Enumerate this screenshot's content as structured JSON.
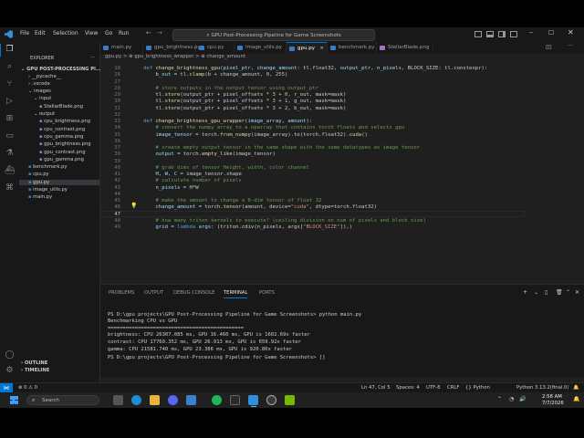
{
  "title_menu": [
    "File",
    "Edit",
    "Selection",
    "View",
    "Go",
    "Run"
  ],
  "command_center": "GPU Post-Processing Pipeline for Game Screenshots",
  "explorer": {
    "header": "EXPLORER",
    "root": "GPU POST-PROCESSING PI...",
    "items": [
      {
        "label": "__pycache__",
        "depth": 1,
        "kind": "folder-closed"
      },
      {
        "label": ".vscode",
        "depth": 1,
        "kind": "folder-closed"
      },
      {
        "label": "images",
        "depth": 1,
        "kind": "folder-open"
      },
      {
        "label": "input",
        "depth": 2,
        "kind": "folder-open"
      },
      {
        "label": "StellarBlade.png",
        "depth": 3,
        "kind": "file"
      },
      {
        "label": "output",
        "depth": 2,
        "kind": "folder-open"
      },
      {
        "label": "cpu_brightness.png",
        "depth": 3,
        "kind": "file"
      },
      {
        "label": "cpu_contrast.png",
        "depth": 3,
        "kind": "file"
      },
      {
        "label": "cpu_gamma.png",
        "depth": 3,
        "kind": "file"
      },
      {
        "label": "gpu_brightness.png",
        "depth": 3,
        "kind": "file"
      },
      {
        "label": "gpu_contrast.png",
        "depth": 3,
        "kind": "file"
      },
      {
        "label": "gpu_gamma.png",
        "depth": 3,
        "kind": "file"
      },
      {
        "label": "benchmark.py",
        "depth": 1,
        "kind": "file"
      },
      {
        "label": "cpu.py",
        "depth": 1,
        "kind": "file"
      },
      {
        "label": "gpu.py",
        "depth": 1,
        "kind": "file",
        "selected": true
      },
      {
        "label": "image_utils.py",
        "depth": 1,
        "kind": "file"
      },
      {
        "label": "main.py",
        "depth": 1,
        "kind": "file"
      }
    ],
    "outline": "OUTLINE",
    "timeline": "TIMELINE"
  },
  "tabs": [
    {
      "label": "main.py",
      "active": false
    },
    {
      "label": "gpu_brightness.py",
      "active": false
    },
    {
      "label": "cpu.py",
      "active": false
    },
    {
      "label": "image_utils.py",
      "active": false
    },
    {
      "label": "gpu.py",
      "active": true
    },
    {
      "label": "benchmark.py",
      "active": false
    },
    {
      "label": "StellarBlade.png",
      "active": false
    }
  ],
  "breadcrumb": "gpu.py > ⊕ gpu_brightness_wrapper > ⊕ change_amount",
  "code_lines": [
    {
      "n": "18",
      "parts": [
        [
          "kw",
          "def "
        ],
        [
          "fn",
          "change_brightness_gpu"
        ],
        [
          "",
          "("
        ],
        [
          "var",
          "pixel_ptr"
        ],
        [
          "",
          ", "
        ],
        [
          "var",
          "change_amount"
        ],
        [
          "",
          ": tl.float32, "
        ],
        [
          "var",
          "output_ptr"
        ],
        [
          "",
          ", "
        ],
        [
          "var",
          "n_pixels"
        ],
        [
          "",
          ", BLOCK_SIZE: tl.constexpr):"
        ]
      ]
    },
    {
      "n": "26",
      "parts": [
        [
          "",
          "    "
        ],
        [
          "var",
          "b_out"
        ],
        [
          "",
          " = tl."
        ],
        [
          "fn",
          "clamp"
        ],
        [
          "",
          "(b + change_amount, "
        ],
        [
          "num",
          "0"
        ],
        [
          "",
          ", "
        ],
        [
          "num",
          "255"
        ],
        [
          "",
          ")"
        ]
      ]
    },
    {
      "n": "27",
      "parts": [
        [
          "",
          ""
        ]
      ]
    },
    {
      "n": "28",
      "parts": [
        [
          "cm",
          "    # store outputs in the output tensor using output_ptr"
        ]
      ]
    },
    {
      "n": "29",
      "parts": [
        [
          "",
          "    tl."
        ],
        [
          "fn",
          "store"
        ],
        [
          "",
          "(output_ptr + pixel_offsets * "
        ],
        [
          "num",
          "3"
        ],
        [
          "",
          " + "
        ],
        [
          "num",
          "0"
        ],
        [
          "",
          ", r_out, mask=mask)"
        ]
      ]
    },
    {
      "n": "30",
      "parts": [
        [
          "",
          "    tl."
        ],
        [
          "fn",
          "store"
        ],
        [
          "",
          "(output_ptr + pixel_offsets * "
        ],
        [
          "num",
          "3"
        ],
        [
          "",
          " + "
        ],
        [
          "num",
          "1"
        ],
        [
          "",
          ", g_out, mask=mask)"
        ]
      ]
    },
    {
      "n": "31",
      "parts": [
        [
          "",
          "    tl."
        ],
        [
          "fn",
          "store"
        ],
        [
          "",
          "(output_ptr + pixel_offsets * "
        ],
        [
          "num",
          "3"
        ],
        [
          "",
          " + "
        ],
        [
          "num",
          "2"
        ],
        [
          "",
          ", b_out, mask=mask)"
        ]
      ]
    },
    {
      "n": "32",
      "parts": [
        [
          "",
          ""
        ]
      ]
    },
    {
      "n": "33",
      "parts": [
        [
          "kw",
          "def "
        ],
        [
          "fn",
          "change_brightness_gpu_wrapper"
        ],
        [
          "",
          "("
        ],
        [
          "var",
          "image_array"
        ],
        [
          "",
          ", "
        ],
        [
          "var",
          "amount"
        ],
        [
          "",
          "):"
        ]
      ]
    },
    {
      "n": "34",
      "parts": [
        [
          "cm",
          "    # convert the numpy array to a nparray that contains torch floats and selects gpu"
        ]
      ]
    },
    {
      "n": "35",
      "parts": [
        [
          "",
          "    "
        ],
        [
          "var",
          "image_tensor"
        ],
        [
          "",
          " = torch."
        ],
        [
          "fn",
          "from_numpy"
        ],
        [
          "",
          "(image_array)."
        ],
        [
          "fn",
          "to"
        ],
        [
          "",
          "(torch.float32)."
        ],
        [
          "fn",
          "cuda"
        ],
        [
          "",
          "()"
        ]
      ]
    },
    {
      "n": "36",
      "parts": [
        [
          "",
          ""
        ]
      ]
    },
    {
      "n": "37",
      "parts": [
        [
          "cm",
          "    # create empty output tensor in the same shape with the same datatypes as image tensor"
        ]
      ]
    },
    {
      "n": "38",
      "parts": [
        [
          "",
          "    "
        ],
        [
          "var",
          "output"
        ],
        [
          "",
          " = torch."
        ],
        [
          "fn",
          "empty_like"
        ],
        [
          "",
          "(image_tensor)"
        ]
      ]
    },
    {
      "n": "39",
      "parts": [
        [
          "",
          ""
        ]
      ]
    },
    {
      "n": "40",
      "parts": [
        [
          "cm",
          "    # grab dims of tensor Height, width, color channel"
        ]
      ]
    },
    {
      "n": "41",
      "parts": [
        [
          "",
          "    "
        ],
        [
          "var",
          "H"
        ],
        [
          "",
          ", "
        ],
        [
          "var",
          "W"
        ],
        [
          "",
          ", "
        ],
        [
          "var",
          "C"
        ],
        [
          "",
          " = image_tensor.shape"
        ]
      ]
    },
    {
      "n": "42",
      "parts": [
        [
          "cm",
          "    # calculate number of pixels"
        ]
      ]
    },
    {
      "n": "43",
      "parts": [
        [
          "",
          "    "
        ],
        [
          "var",
          "n_pixels"
        ],
        [
          "",
          " = H*W"
        ]
      ]
    },
    {
      "n": "44",
      "parts": [
        [
          "",
          ""
        ]
      ]
    },
    {
      "n": "45",
      "parts": [
        [
          "cm",
          "    # make the amount to change a 0-dim tensor of float 32"
        ]
      ]
    },
    {
      "n": "46",
      "parts": [
        [
          "",
          "    "
        ],
        [
          "var",
          "change_amount"
        ],
        [
          "",
          " = torch."
        ],
        [
          "fn",
          "tensor"
        ],
        [
          "",
          "(amount, device="
        ],
        [
          "str",
          "\"cuda\""
        ],
        [
          "",
          ", dtype=torch.float32)"
        ]
      ]
    },
    {
      "n": "47",
      "parts": [
        [
          "",
          ""
        ]
      ]
    },
    {
      "n": "48",
      "parts": [
        [
          "cm",
          "    # how many triton kernels to execute? (ceiling division on num of pixels and block size)"
        ]
      ]
    },
    {
      "n": "49",
      "parts": [
        [
          "",
          "    "
        ],
        [
          "var",
          "grid"
        ],
        [
          "",
          " = "
        ],
        [
          "kw",
          "lambda "
        ],
        [
          "var",
          "args"
        ],
        [
          "",
          ": (triton."
        ],
        [
          "fn",
          "cdiv"
        ],
        [
          "",
          "(n_pixels, args["
        ],
        [
          "str",
          "\"BLOCK_SIZE\""
        ],
        [
          "",
          "]),)"
        ]
      ]
    }
  ],
  "panel": {
    "tabs": [
      "PROBLEMS",
      "OUTPUT",
      "DEBUG CONSOLE",
      "TERMINAL",
      "PORTS"
    ],
    "active_tab": "TERMINAL",
    "terminal_lines": [
      "PS D:\\gpu projects\\GPU Post-Processing Pipeline for Game Screenshots> python main.py",
      "Benchmarking CPU vs GPU",
      "=============================================",
      "brightness: CPU 26307.085 ms, GPU 16.460 ms, GPU is 1602.69x faster",
      "contrast: CPU 17760.352 ms, GPU 26.913 ms, GPU is 659.92x faster",
      "gamma: CPU 21581.740 ms, GPU 23.386 ms, GPU is 920.80x faster",
      "PS D:\\gpu projects\\GPU Post-Processing Pipeline for Game Screenshots> []"
    ]
  },
  "statusbar": {
    "position": "Ln 47, Col 5",
    "spaces": "Spaces: 4",
    "encoding": "UTF-8",
    "eol": "CRLF",
    "language": "Python",
    "interpreter": "Python 3.13.2(final.0)"
  },
  "taskbar": {
    "search_placeholder": "Search",
    "time": "2:58 AM",
    "date": "7/7/2026"
  }
}
